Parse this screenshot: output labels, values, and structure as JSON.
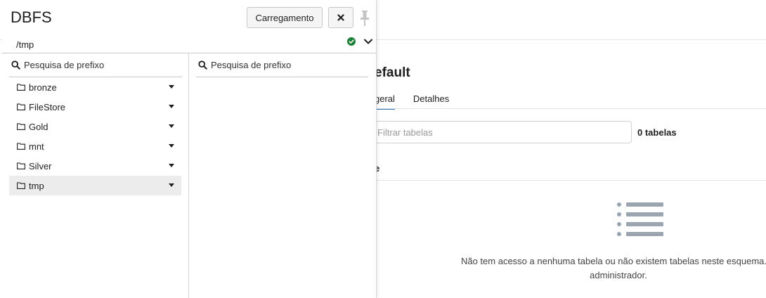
{
  "background": {
    "title": "efault",
    "tabs": [
      {
        "label": "geral",
        "active": true
      },
      {
        "label": "Detalhes",
        "active": false
      }
    ],
    "filter_placeholder": "Filtrar tabelas",
    "table_count": "0 tabelas",
    "column_header": "e",
    "empty_message_line1": "Não tem acesso a nenhuma tabela ou não existem tabelas neste esquema. C",
    "empty_message_line2": "administrador.",
    "empty_icon": "list-icon"
  },
  "dbfs": {
    "title": "DBFS",
    "upload_label": "Carregamento",
    "close_icon": "close-icon",
    "pin_icon": "pin-icon",
    "path": "/tmp",
    "status_icon": "check-circle-icon",
    "status_color": "#1a7f37",
    "search_left_placeholder": "Pesquisa de prefixo",
    "search_right_placeholder": "Pesquisa de prefixo",
    "folders": [
      {
        "label": "bronze",
        "selected": false
      },
      {
        "label": "FileStore",
        "selected": false
      },
      {
        "label": "Gold",
        "selected": false
      },
      {
        "label": "mnt",
        "selected": false
      },
      {
        "label": "Silver",
        "selected": false
      },
      {
        "label": "tmp",
        "selected": true
      }
    ]
  },
  "colors": {
    "accent": "#2272b4",
    "selected_row": "#ececec",
    "icon_gray": "#9aa5b1"
  }
}
